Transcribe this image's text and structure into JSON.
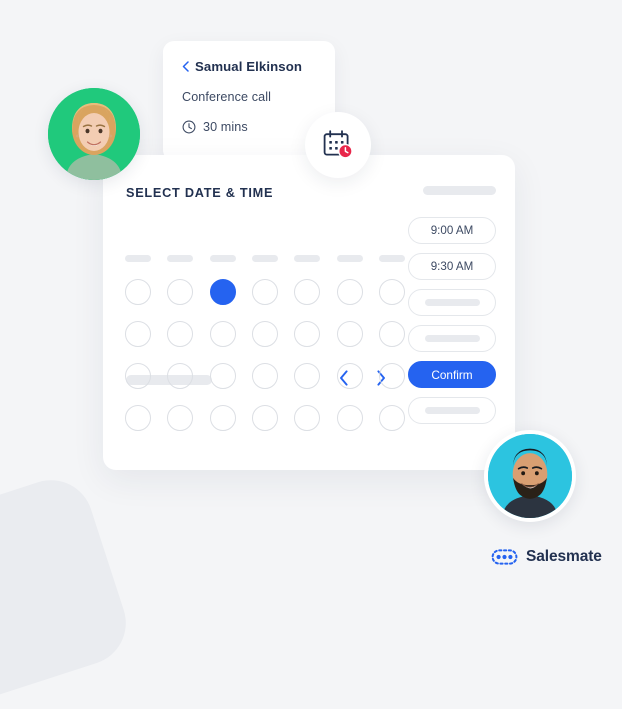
{
  "theme": {
    "background": "#f4f5f7",
    "card_background": "#ffffff",
    "accent_blue": "#2563f0",
    "text_dark": "#223150",
    "text_body": "#3d4a63",
    "skeleton_gray": "#e8eaee",
    "avatar_left_bg": "#20c97c",
    "avatar_right_bg": "#2cc4e0",
    "badge_red": "#e8264a",
    "deco_shape": "#eaecf0"
  },
  "event_card": {
    "back_icon": "chevron-left-icon",
    "person_name": "Samual Elkinson",
    "meeting_type": "Conference call",
    "duration_icon": "clock-icon",
    "duration": "30 mins"
  },
  "calendar_badge": {
    "icon": "calendar-clock-icon"
  },
  "scheduler": {
    "title": "SELECT DATE & TIME",
    "header_placeholder": "",
    "month_placeholder": "",
    "prev_icon": "chevron-left-icon",
    "next_icon": "chevron-right-icon",
    "weekdays": [
      "",
      "",
      "",
      "",
      "",
      "",
      ""
    ],
    "date_rows": [
      [
        {
          "label": "",
          "selected": false
        },
        {
          "label": "",
          "selected": false
        },
        {
          "label": "",
          "selected": true
        },
        {
          "label": "",
          "selected": false
        },
        {
          "label": "",
          "selected": false
        },
        {
          "label": "",
          "selected": false
        },
        {
          "label": "",
          "selected": false
        }
      ],
      [
        {
          "label": "",
          "selected": false
        },
        {
          "label": "",
          "selected": false
        },
        {
          "label": "",
          "selected": false
        },
        {
          "label": "",
          "selected": false
        },
        {
          "label": "",
          "selected": false
        },
        {
          "label": "",
          "selected": false
        },
        {
          "label": "",
          "selected": false
        }
      ],
      [
        {
          "label": "",
          "selected": false
        },
        {
          "label": "",
          "selected": false
        },
        {
          "label": "",
          "selected": false
        },
        {
          "label": "",
          "selected": false
        },
        {
          "label": "",
          "selected": false
        },
        {
          "label": "",
          "selected": false
        },
        {
          "label": "",
          "selected": false
        }
      ],
      [
        {
          "label": "",
          "selected": false
        },
        {
          "label": "",
          "selected": false
        },
        {
          "label": "",
          "selected": false
        },
        {
          "label": "",
          "selected": false
        },
        {
          "label": "",
          "selected": false
        },
        {
          "label": "",
          "selected": false
        },
        {
          "label": "",
          "selected": false
        }
      ]
    ],
    "time_slots": [
      {
        "label": "9:00 AM",
        "type": "time"
      },
      {
        "label": "9:30 AM",
        "type": "time"
      },
      {
        "label": "",
        "type": "placeholder"
      },
      {
        "label": "",
        "type": "placeholder"
      },
      {
        "label": "Confirm",
        "type": "confirm"
      },
      {
        "label": "",
        "type": "placeholder"
      }
    ]
  },
  "avatars": {
    "left": "avatar-woman",
    "right": "avatar-man"
  },
  "brand": {
    "mark": "salesmate-logo-icon",
    "name": "Salesmate"
  }
}
